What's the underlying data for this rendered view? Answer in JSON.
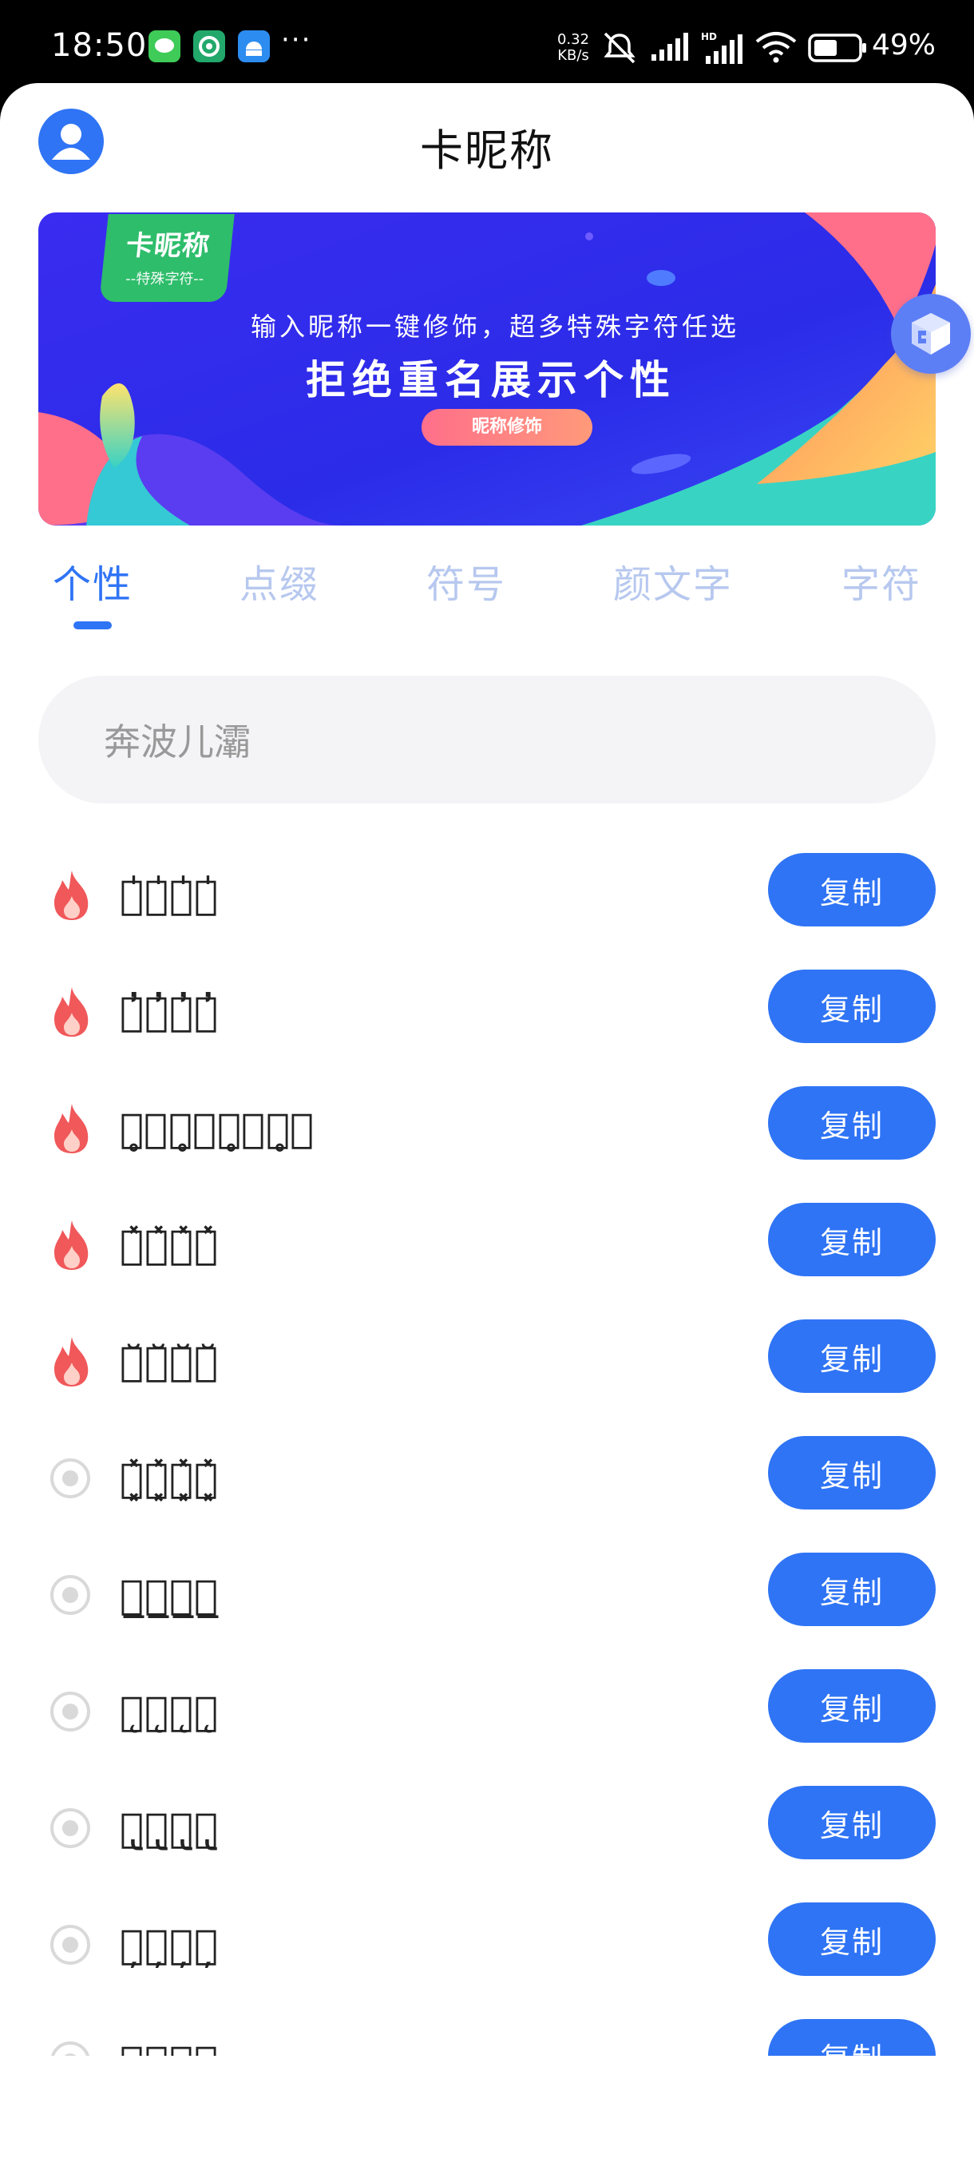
{
  "status_bar": {
    "time": "18:50",
    "more": "···",
    "net_speed_value": "0.32",
    "net_speed_unit": "KB/s",
    "battery": "49%"
  },
  "header": {
    "title": "卡昵称"
  },
  "banner": {
    "badge_title": "卡昵称",
    "badge_subtitle": "--特殊字符--",
    "line1": "输入昵称一键修饰，超多特殊字符任选",
    "line2": "拒绝重名展示个性",
    "button": "昵称修饰"
  },
  "tabs": [
    {
      "label": "个性",
      "active": true
    },
    {
      "label": "点缀",
      "active": false
    },
    {
      "label": "符号",
      "active": false
    },
    {
      "label": "颜文字",
      "active": false
    },
    {
      "label": "字符",
      "active": false
    }
  ],
  "search": {
    "value": "奔波儿灞"
  },
  "list": {
    "copy_label": "复制",
    "items": [
      {
        "text": "奔̍波̍儿̍灞̍",
        "icon": "fire-icon"
      },
      {
        "text": "奔̓波̓儿̓灞̓",
        "icon": "fire-icon"
      },
      {
        "text": "奔̥ͦ波̥ͦ儿̥ͦ灞̥ͦ",
        "icon": "fire-icon"
      },
      {
        "text": "奔̽波̽儿̽灞̽",
        "icon": "fire-icon"
      },
      {
        "text": "奔̆波̆儿̆灞̆",
        "icon": "fire-icon"
      },
      {
        "text": "奔͓̽波͓̽儿͓̽灞͓̽",
        "icon": "circle-dot-icon"
      },
      {
        "text": "奔̲̲波̲̲儿̲̲灞̲̲",
        "icon": "circle-dot-icon"
      },
      {
        "text": "奔̨波̨儿̨灞̨",
        "icon": "circle-dot-icon"
      },
      {
        "text": "奔̢波̢儿̢灞̢",
        "icon": "circle-dot-icon"
      },
      {
        "text": "奔̦波̦儿̦灞̦",
        "icon": "circle-dot-icon"
      },
      {
        "text": "奔̳波̳儿̳灞̳",
        "icon": "circle-dot-icon"
      }
    ]
  },
  "colors": {
    "accent": "#2f74f5",
    "tab_inactive": "#b7c8ef",
    "fire": "#f0585a",
    "search_bg": "#f4f4f6"
  },
  "bottom_nav": [
    "menu-icon",
    "home-square-icon",
    "back-chevron-icon"
  ]
}
